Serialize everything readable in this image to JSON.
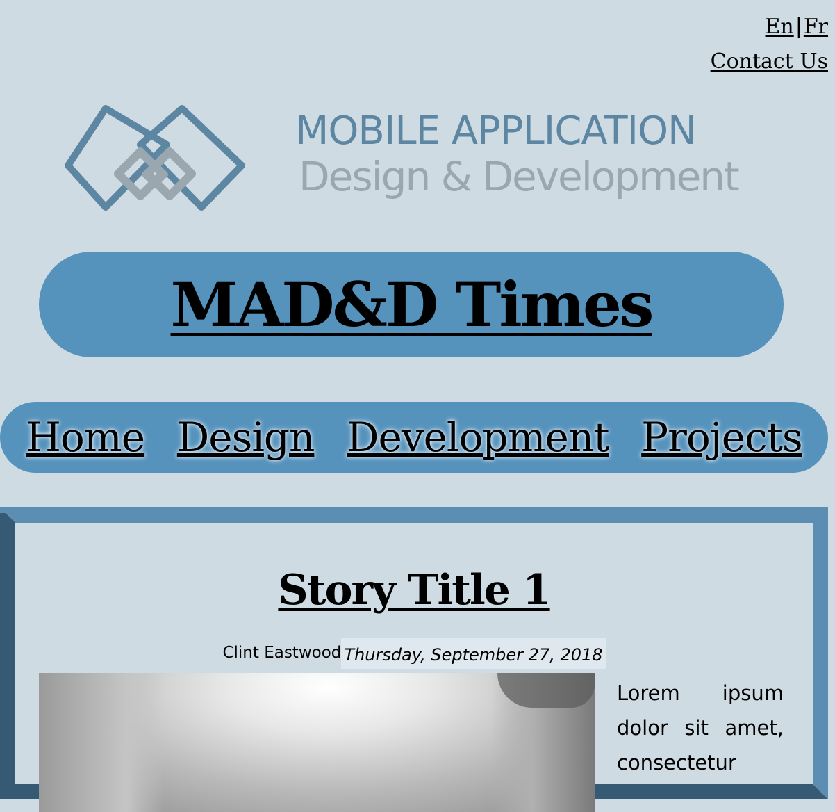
{
  "header": {
    "lang_en": "En",
    "lang_separator": "|",
    "lang_fr": "Fr",
    "contact": "Contact Us"
  },
  "logo": {
    "line1": "MOBILE APPLICATION",
    "line2": "Design & Development",
    "icon": "linked-diamonds-icon"
  },
  "masthead": {
    "title": "MAD&D Times"
  },
  "nav": {
    "items": [
      {
        "label": "Home"
      },
      {
        "label": "Design"
      },
      {
        "label": "Development"
      },
      {
        "label": "Projects"
      }
    ]
  },
  "story": {
    "title": "Story Title 1",
    "author": "Clint Eastwood",
    "date": "Thursday, September 27, 2018",
    "text": "Lorem ipsum dolor sit amet, consectetur"
  },
  "colors": {
    "background": "#cfdbe3",
    "accent": "#5592bc",
    "panel_dark": "#375a74",
    "logo_blue": "#5c86a2",
    "logo_gray": "#9aa7af"
  }
}
